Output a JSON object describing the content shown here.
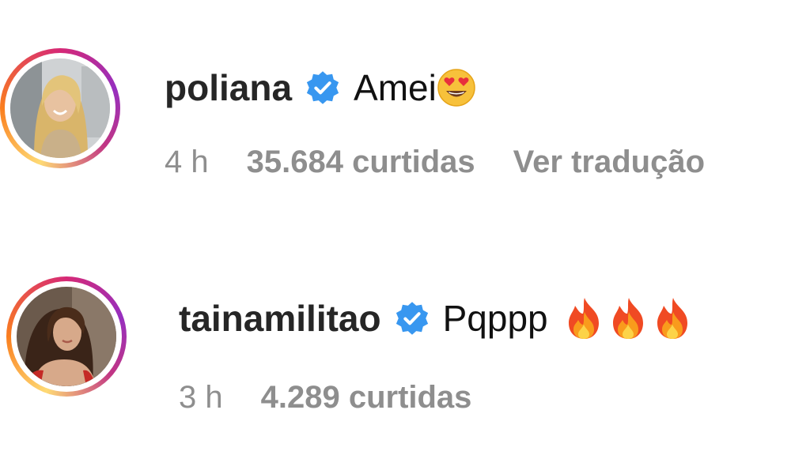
{
  "comments": [
    {
      "username": "poliana",
      "verified": true,
      "text": "Amei",
      "emoji": "heart-eyes-emoji",
      "time": "4 h",
      "likes": "35.684 curtidas",
      "translate": "Ver tradução"
    },
    {
      "username": "tainamilitao",
      "verified": true,
      "text": "Pqppp",
      "emoji": "fire-emoji x3",
      "time": "3 h",
      "likes": "4.289 curtidas"
    }
  ],
  "colors": {
    "verified_blue": "#3897f0",
    "meta_gray": "#8e8e8e",
    "username": "#262626"
  }
}
